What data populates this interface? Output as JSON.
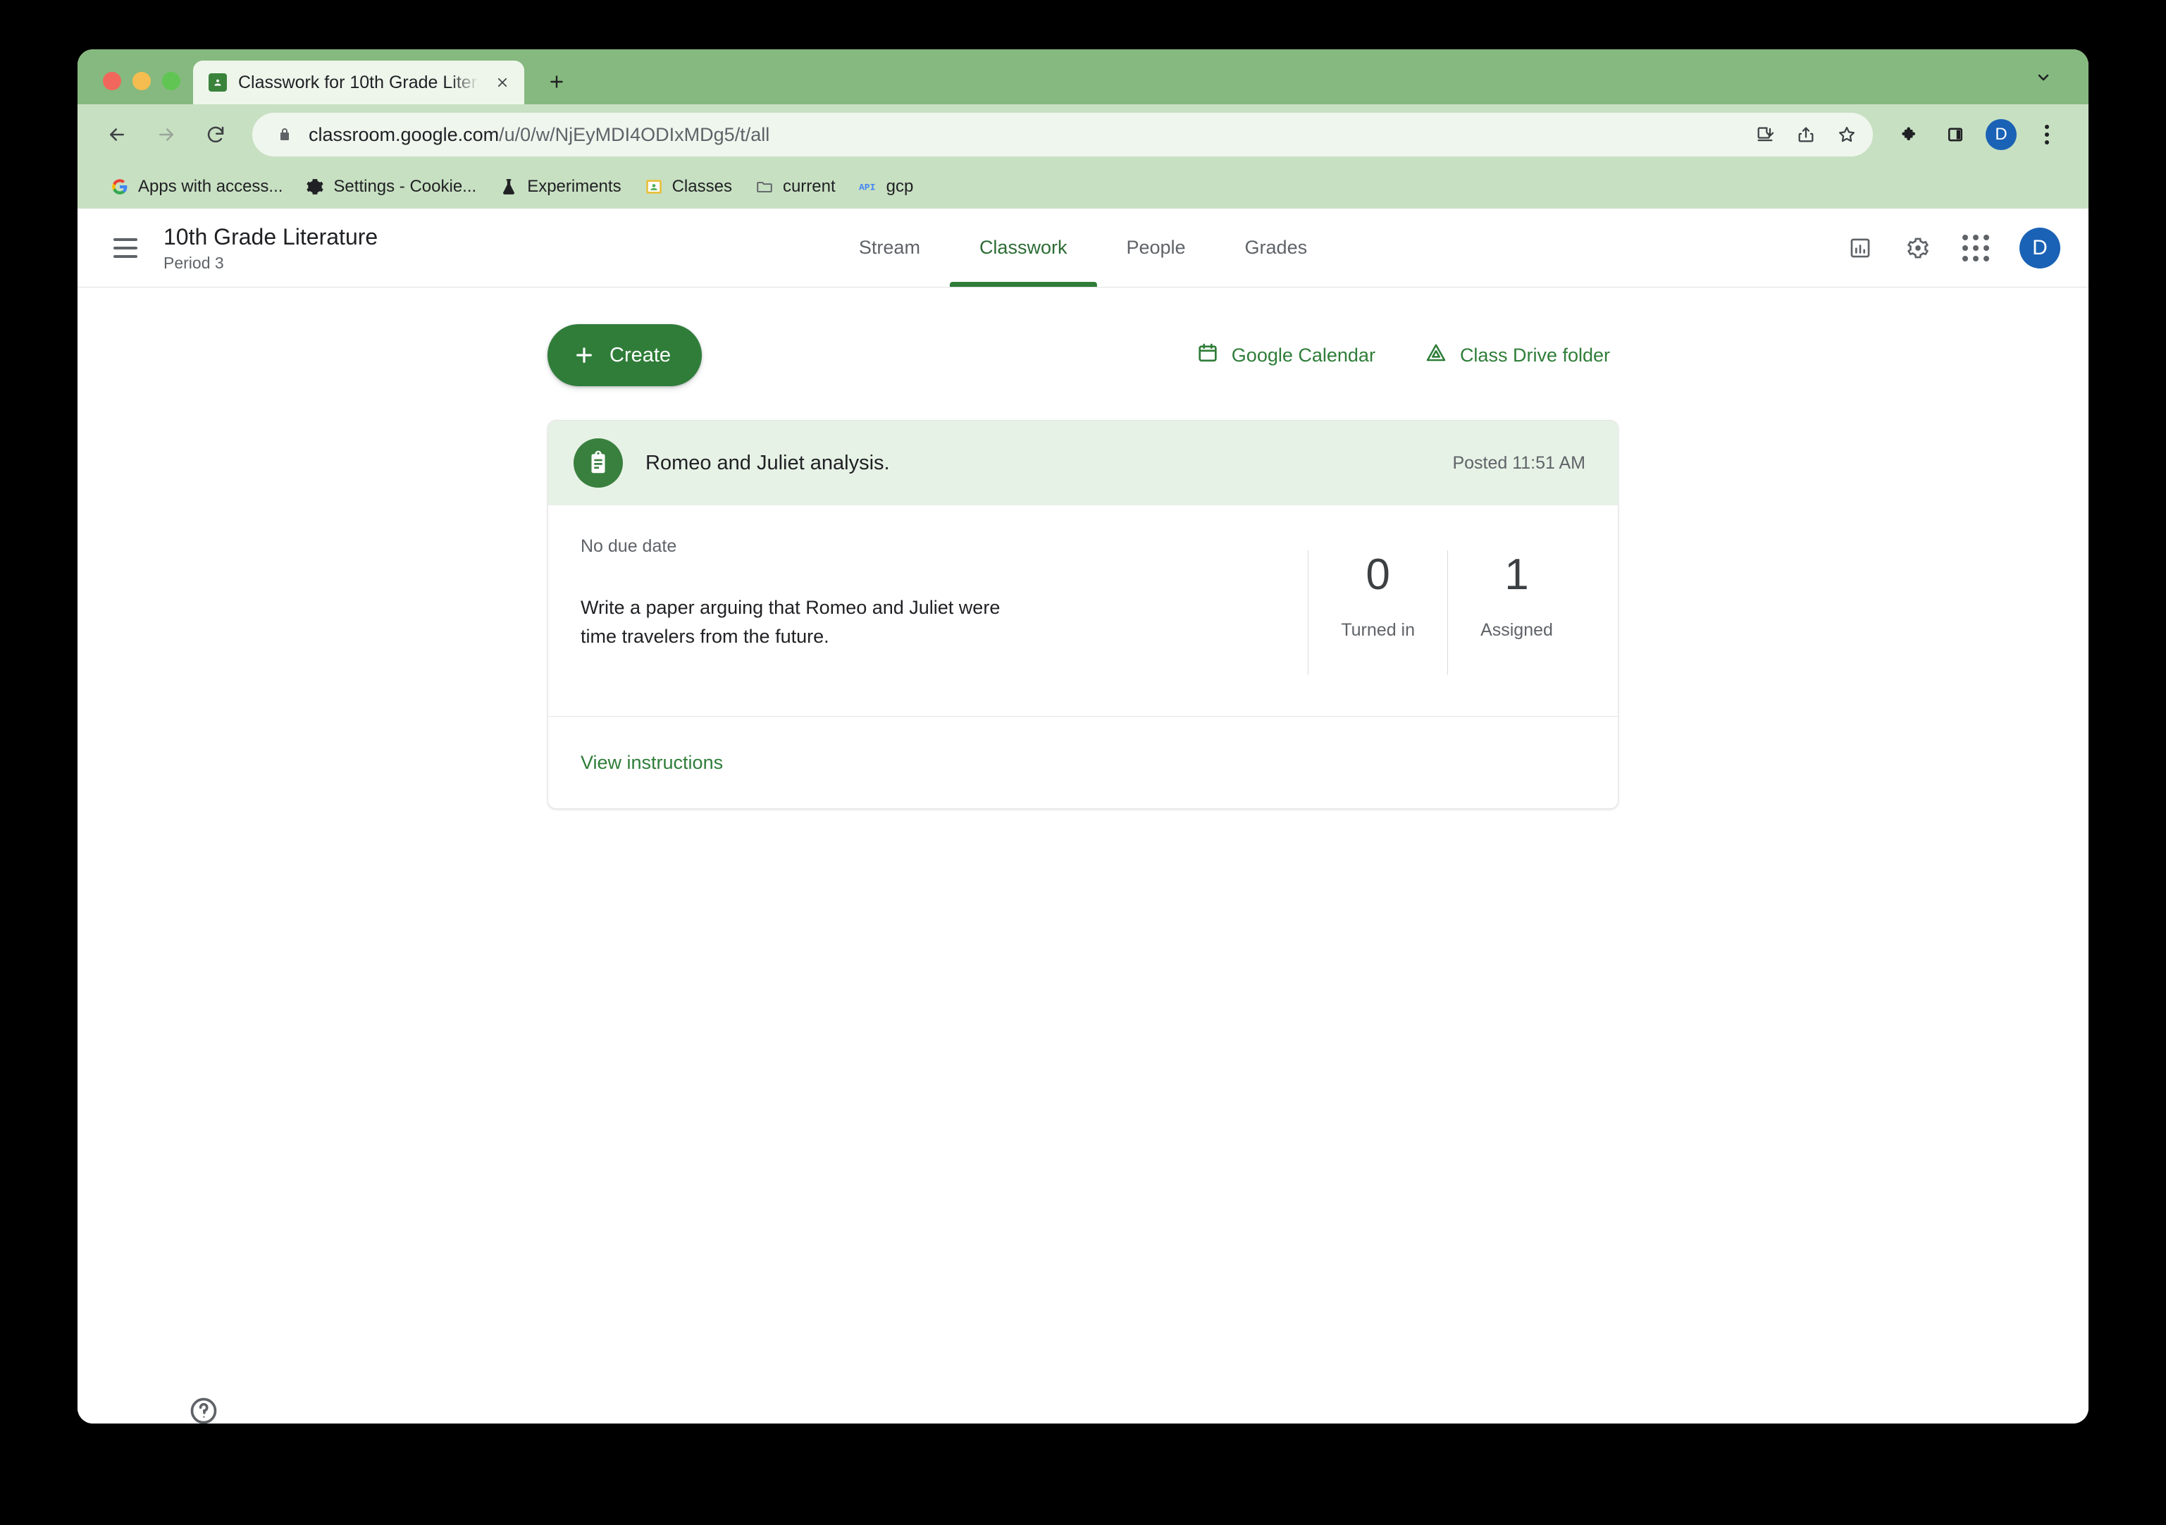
{
  "browser": {
    "tab": {
      "title": "Classwork for 10th Grade Litera",
      "favicon": "google-classroom-icon",
      "close": "close-icon"
    },
    "new_tab_label": "+",
    "tab_list_chevron": "chevron-down-icon",
    "toolbar": {
      "back": "back-arrow-icon",
      "forward": "forward-arrow-icon",
      "reload": "reload-icon",
      "lock": "lock-icon",
      "url_host": "classroom.google.com",
      "url_path": "/u/0/w/NjEyMDI4ODIxMDg5/t/all",
      "url_full": "classroom.google.com/u/0/w/NjEyMDI4ODIxMDg5/t/all",
      "install": "install-icon",
      "share": "share-icon",
      "bookmark": "star-icon",
      "extensions": "puzzle-piece-icon",
      "side_panel": "side-panel-icon",
      "profile_initial": "D",
      "menu": "three-dot-menu-icon"
    },
    "bookmarks": [
      {
        "label": "Apps with access...",
        "icon": "google-g-icon"
      },
      {
        "label": "Settings - Cookie...",
        "icon": "gear-icon"
      },
      {
        "label": "Experiments",
        "icon": "flask-icon"
      },
      {
        "label": "Classes",
        "icon": "google-classroom-icon"
      },
      {
        "label": "current",
        "icon": "folder-icon"
      },
      {
        "label": "gcp",
        "icon": "api-icon"
      }
    ]
  },
  "app_header": {
    "menu_icon": "hamburger-menu-icon",
    "class_title": "10th Grade Literature",
    "class_section": "Period 3",
    "tabs": [
      {
        "label": "Stream",
        "active": false
      },
      {
        "label": "Classwork",
        "active": true
      },
      {
        "label": "People",
        "active": false
      },
      {
        "label": "Grades",
        "active": false
      }
    ],
    "actions": {
      "insights": "bar-chart-icon",
      "settings": "gear-icon",
      "apps": "apps-grid-icon",
      "avatar_initial": "D"
    }
  },
  "content": {
    "create_button": "Create",
    "links": [
      {
        "label": "Google Calendar",
        "icon": "calendar-icon"
      },
      {
        "label": "Class Drive folder",
        "icon": "drive-icon"
      }
    ],
    "assignment": {
      "icon": "clipboard-assignment-icon",
      "title": "Romeo and Juliet analysis.",
      "posted": "Posted 11:51 AM",
      "due_date": "No due date",
      "description": "Write a paper arguing that Romeo and Juliet were time travelers from the future.",
      "counters": [
        {
          "value": "0",
          "label": "Turned in"
        },
        {
          "value": "1",
          "label": "Assigned"
        }
      ],
      "footer_link": "View instructions"
    },
    "help_icon": "help-circle-icon"
  },
  "colors": {
    "accent_green": "#2f7d39",
    "card_header_green": "#e7f2e6",
    "tabstrip_green": "#86b97f",
    "toolbar_green": "#c8e0c2",
    "avatar_blue": "#1a62b5"
  }
}
